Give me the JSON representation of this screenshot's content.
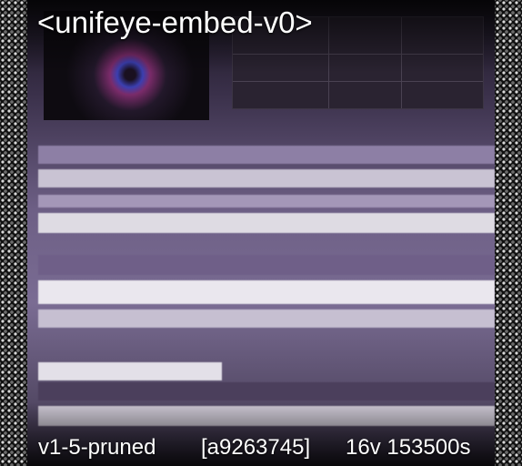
{
  "overlay": {
    "title": "<unifeye-embed-v0>",
    "footer_left": "v1-5-pruned",
    "footer_mid": "[a9263745]",
    "footer_right": "16v 153500s"
  }
}
